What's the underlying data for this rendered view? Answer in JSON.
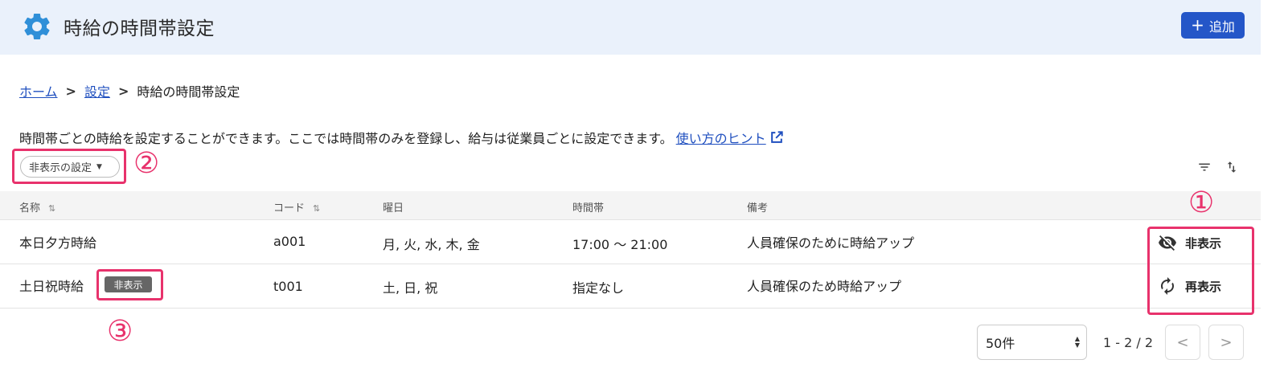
{
  "header": {
    "title": "時給の時間帯設定",
    "add_label": "追加",
    "add_icon": "plus-icon",
    "settings_icon": "gear-icon",
    "accent": "#2456c8"
  },
  "breadcrumb": {
    "home": "ホーム",
    "settings": "設定",
    "current": "時給の時間帯設定"
  },
  "description": {
    "text": "時間帯ごとの時給を設定することができます。ここでは時間帯のみを登録し、給与は従業員ごとに設定できます。",
    "hint_link": "使い方のヒント"
  },
  "filter": {
    "hidden_settings_label": "非表示の設定"
  },
  "annotations": {
    "one": "①",
    "two": "②",
    "three": "③",
    "color": "#e8326c"
  },
  "table": {
    "columns": [
      "名称",
      "コード",
      "曜日",
      "時間帯",
      "備考"
    ],
    "rows": [
      {
        "name": "本日夕方時給",
        "code": "a001",
        "days": "月, 火, 水, 木, 金",
        "time": "17:00 〜 21:00",
        "note": "人員確保のために時給アップ",
        "action": "非表示",
        "action_icon": "eye-off-icon"
      },
      {
        "name": "土日祝時給",
        "badge": "非表示",
        "code": "t001",
        "days": "土, 日, 祝",
        "time": "指定なし",
        "note": "人員確保のため時給アップ",
        "action": "再表示",
        "action_icon": "refresh-icon"
      }
    ]
  },
  "pagination": {
    "per_page": "50件",
    "range": "1 - 2 / 2"
  }
}
